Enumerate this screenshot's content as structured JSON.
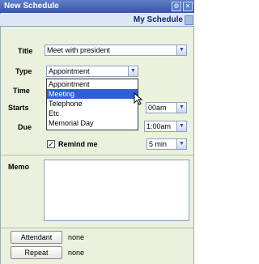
{
  "window": {
    "title": "New Schedule"
  },
  "subheader": {
    "label": "My Schedule"
  },
  "form": {
    "title_label": "Title",
    "title_value": "Meet with president",
    "type_label": "Type",
    "type_value": "Appointment",
    "type_options": [
      "Appointment",
      "Meeting",
      "Telephone",
      "Etc",
      "Memorial Day"
    ],
    "type_highlighted_index": 1,
    "time_label": "Time",
    "starts_label": "Starts",
    "starts_time": "00am",
    "due_label": "Due",
    "due_time": "1:00am",
    "remind_label": "Remind me",
    "remind_checked": true,
    "remind_value": "5 min",
    "memo_label": "Memo"
  },
  "buttons": {
    "attendant_label": "Attendant",
    "attendant_value": "none",
    "repeat_label": "Repeat",
    "repeat_value": "none"
  },
  "icons": {
    "dropdown": "chevron-down-icon",
    "check": "check-icon",
    "cursor": "mouse-pointer-icon"
  },
  "colors": {
    "title_bar": "#3656a6",
    "background": "#eaf1dc",
    "highlight": "#2f5fd6",
    "subheader_text": "#0b2670"
  }
}
